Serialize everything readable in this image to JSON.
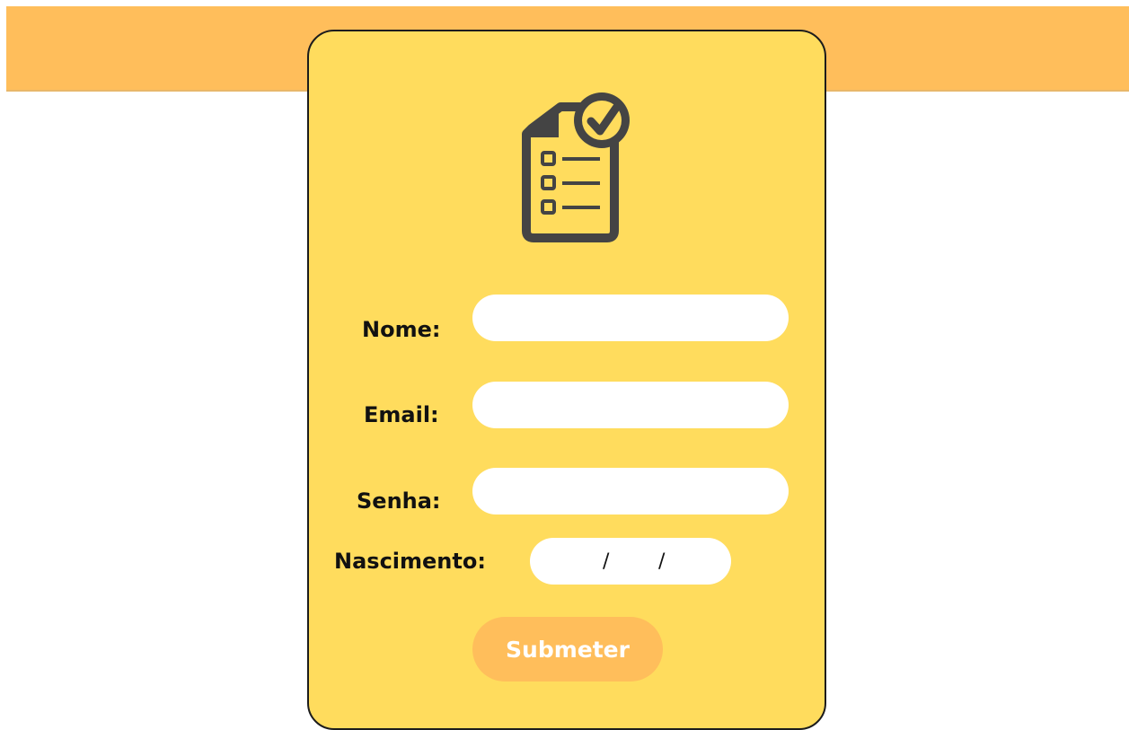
{
  "form": {
    "icon": "checklist-document-icon",
    "fields": [
      {
        "label": "Nome:",
        "value": ""
      },
      {
        "label": "Email:",
        "value": ""
      },
      {
        "label": "Senha:",
        "value": ""
      }
    ],
    "birth": {
      "label": "Nascimento:",
      "separator": "/"
    },
    "submit_label": "Submeter"
  },
  "colors": {
    "band": "#ffbe5b",
    "card": "#ffdc5d",
    "icon": "#444444",
    "field": "#ffffff"
  }
}
